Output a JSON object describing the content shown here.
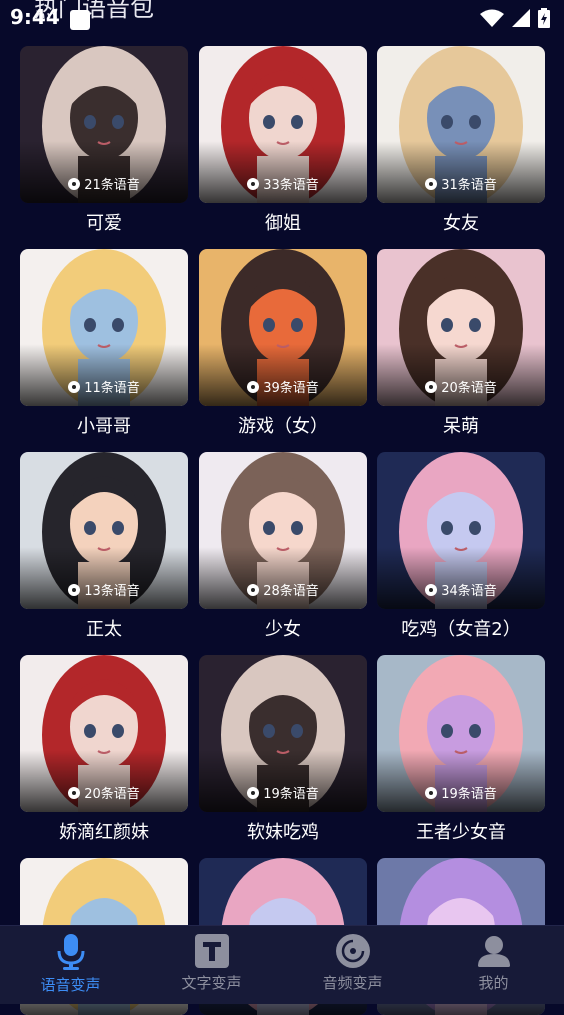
{
  "status": {
    "time": "9:44"
  },
  "header": {
    "title": "热门语音包"
  },
  "cards": [
    {
      "count": "21条语音",
      "name": "可爱",
      "colors": [
        "#2a2230",
        "#d9c7c0",
        "#3a2e2e"
      ]
    },
    {
      "count": "33条语音",
      "name": "御姐",
      "colors": [
        "#f2ecec",
        "#b3272a",
        "#f0d6cf"
      ]
    },
    {
      "count": "31条语音",
      "name": "女友",
      "colors": [
        "#f1eeea",
        "#e6c89a",
        "#7890b8"
      ]
    },
    {
      "count": "11条语音",
      "name": "小哥哥",
      "colors": [
        "#f4f0ee",
        "#f2cc7a",
        "#9ec0e0"
      ]
    },
    {
      "count": "39条语音",
      "name": "游戏（女）",
      "colors": [
        "#e8b46a",
        "#3c2a28",
        "#e86a3a"
      ]
    },
    {
      "count": "20条语音",
      "name": "呆萌",
      "colors": [
        "#e9c3cf",
        "#4a3028",
        "#f6d8d0"
      ]
    },
    {
      "count": "13条语音",
      "name": "正太",
      "colors": [
        "#d8dde3",
        "#26252c",
        "#f4d2bd"
      ]
    },
    {
      "count": "28条语音",
      "name": "少女",
      "colors": [
        "#efeaf0",
        "#7b6258",
        "#f6d7cc"
      ]
    },
    {
      "count": "34条语音",
      "name": "吃鸡（女音2）",
      "colors": [
        "#1f2a55",
        "#e9a6c2",
        "#c5c9f0"
      ]
    },
    {
      "count": "20条语音",
      "name": "娇滴红颜妹",
      "colors": [
        "#f2ecec",
        "#b3272a",
        "#f0d6cf"
      ]
    },
    {
      "count": "19条语音",
      "name": "软妹吃鸡",
      "colors": [
        "#2a2230",
        "#d9c7c0",
        "#3a2e2e"
      ]
    },
    {
      "count": "19条语音",
      "name": "王者少女音",
      "colors": [
        "#a7b8c8",
        "#f2a9b4",
        "#c89ce0"
      ]
    },
    {
      "count": "",
      "name": "",
      "colors": [
        "#f4f0ee",
        "#f2cc7a",
        "#9ec0e0"
      ]
    },
    {
      "count": "",
      "name": "",
      "colors": [
        "#1f2a55",
        "#e9a6c2",
        "#c5c9f0"
      ]
    },
    {
      "count": "",
      "name": "",
      "colors": [
        "#6d79a8",
        "#b48ee0",
        "#e8c6f0"
      ]
    }
  ],
  "nav": [
    {
      "label": "语音变声",
      "icon": "microphone-icon",
      "active": true
    },
    {
      "label": "文字变声",
      "icon": "text-t-icon",
      "active": false
    },
    {
      "label": "音频变声",
      "icon": "audio-disc-icon",
      "active": false
    },
    {
      "label": "我的",
      "icon": "user-icon",
      "active": false
    }
  ],
  "colors": {
    "background": "#07092a",
    "nav_bg": "#171a38",
    "accent": "#3d8df5",
    "inactive": "#8d8f9e"
  }
}
